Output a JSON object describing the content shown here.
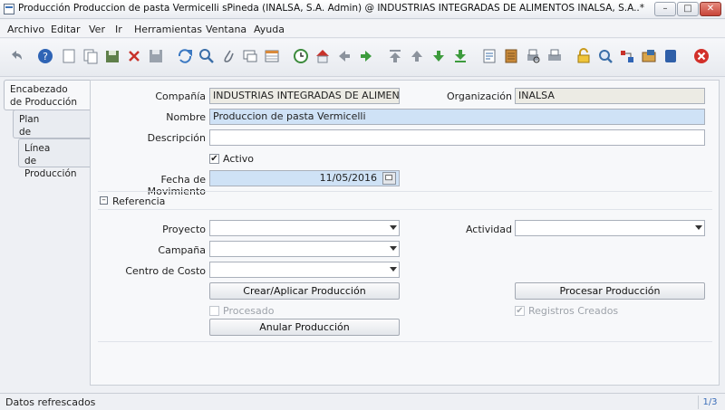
{
  "window": {
    "title": "Producción  Produccion de pasta Vermicelli  sPineda (INALSA, S.A. Admin) @ INDUSTRIAS INTEGRADAS DE ALIMENTOS INALSA, S.A..* [vmtestzenith{...",
    "minimize": "–",
    "maximize": "□",
    "close": "✕"
  },
  "menu": [
    "Archivo",
    "Editar",
    "Ver",
    "Ir",
    "Herramientas",
    "Ventana",
    "Ayuda"
  ],
  "toolbar_icons": [
    "undo-icon",
    "help-icon",
    "new-record-icon",
    "copy-record-icon",
    "save-new-icon",
    "delete-icon",
    "save-icon",
    "refresh-icon",
    "find-icon",
    "attachment-icon",
    "chat-icon",
    "grid-toggle-icon",
    "history-icon",
    "home-icon",
    "previous-icon",
    "next-icon",
    "first-icon",
    "up-icon",
    "down-icon",
    "last-icon",
    "report-icon",
    "archive-icon",
    "print-preview-icon",
    "print-icon",
    "lock-icon",
    "zoom-across-icon",
    "request-icon",
    "product-info-icon",
    "close-window-icon",
    "exit-icon"
  ],
  "tabs": [
    "Encabezado\nde Producción",
    "Plan\nde Producción",
    "Línea\nde Producción"
  ],
  "form": {
    "company_label": "Compañía",
    "company_value": "INDUSTRIAS INTEGRADAS DE ALIMENTOS",
    "org_label": "Organización",
    "org_value": "INALSA",
    "name_label": "Nombre",
    "name_value": "Produccion de pasta Vermicelli",
    "description_label": "Descripción",
    "description_value": "",
    "active_label": "Activo",
    "move_date_label": "Fecha de Movimiento",
    "move_date_value": "11/05/2016",
    "reference_section": "Referencia",
    "project_label": "Proyecto",
    "activity_label": "Actividad",
    "campaign_label": "Campaña",
    "cost_center_label": "Centro de Costo",
    "create_apply_button": "Crear/Aplicar Producción",
    "process_button": "Procesar Producción",
    "processed_label": "Procesado",
    "records_created_label": "Registros Creados",
    "void_button": "Anular Producción"
  },
  "status": {
    "message": "Datos refrescados",
    "page": "1/3"
  },
  "colors": {
    "mandatory_field": "#cfe2f6",
    "readonly_field": "#ecebe4",
    "accent": "#3a6db8"
  }
}
